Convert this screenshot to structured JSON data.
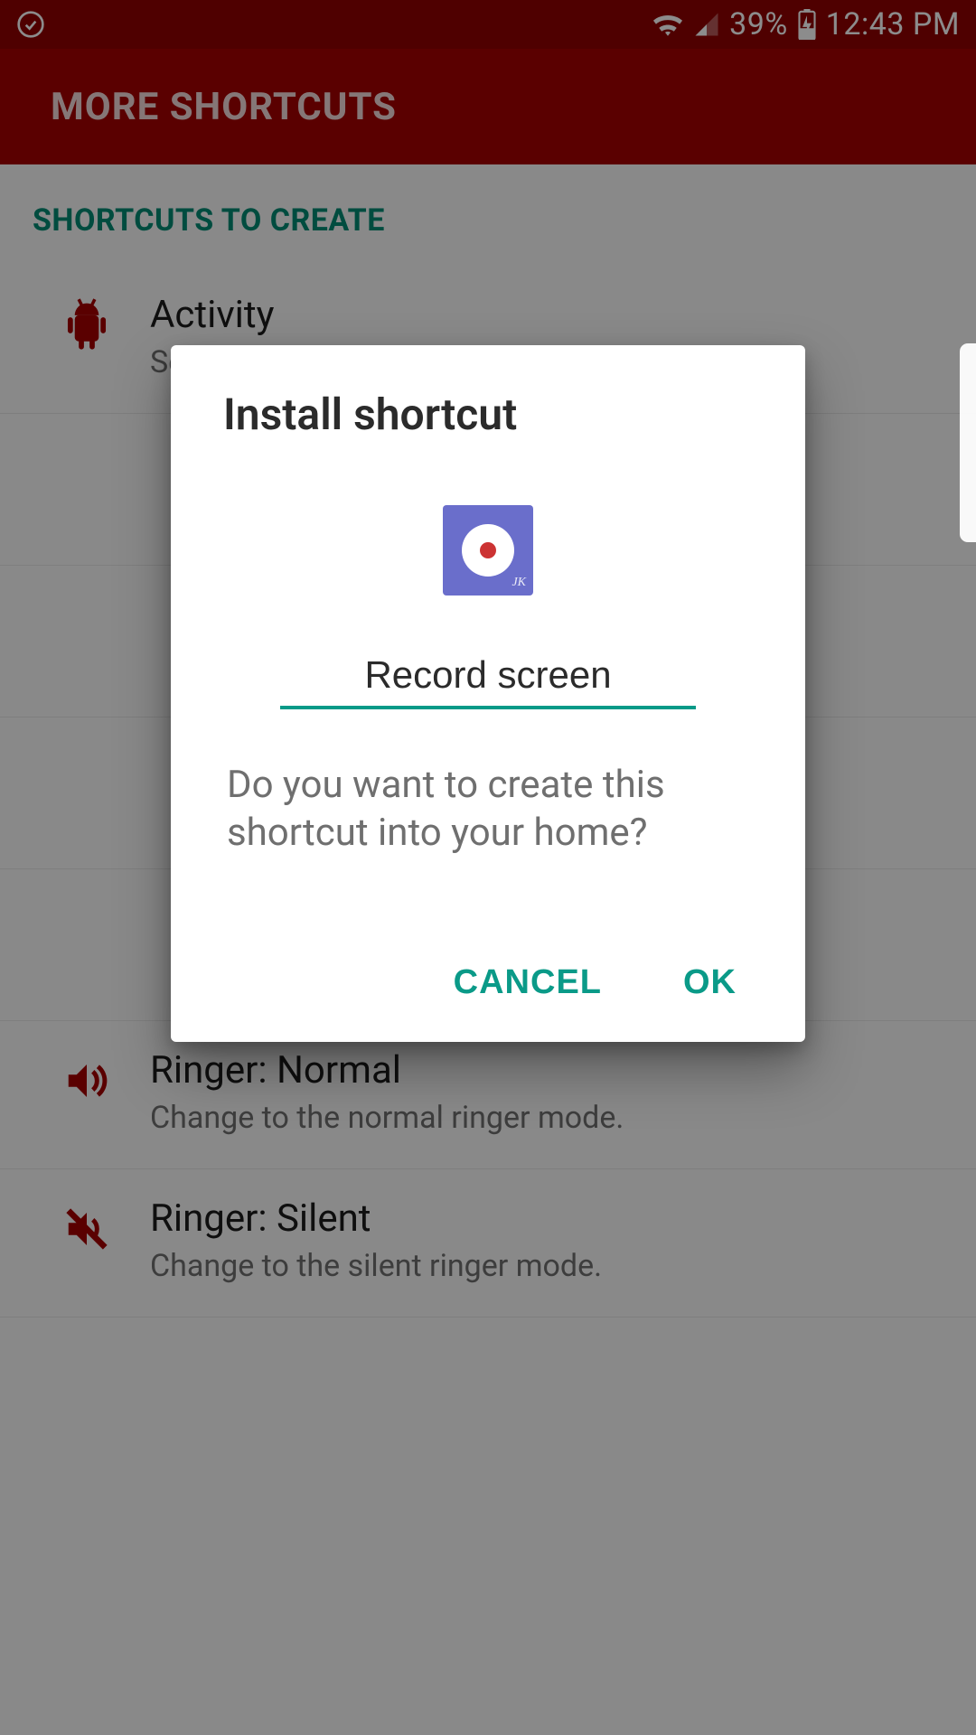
{
  "statusbar": {
    "battery_pct": "39%",
    "time": "12:43 PM"
  },
  "appbar": {
    "title": "MORE SHORTCUTS"
  },
  "section": {
    "header": "SHORTCUTS TO CREATE"
  },
  "rows": [
    {
      "title": "Activity",
      "sub": "Select an activity to launch."
    },
    {
      "title": "",
      "sub": ""
    },
    {
      "title": "",
      "sub": ""
    },
    {
      "title": "",
      "sub": ""
    },
    {
      "title": "",
      "sub": ""
    },
    {
      "title": "Ringer: Normal",
      "sub": "Change to the normal ringer mode."
    },
    {
      "title": "Ringer: Silent",
      "sub": "Change to the silent ringer mode."
    }
  ],
  "dialog": {
    "title": "Install shortcut",
    "shortcut_name": "Record screen",
    "message": "Do you want to create this shortcut into your home?",
    "cancel": "CANCEL",
    "ok": "OK"
  }
}
